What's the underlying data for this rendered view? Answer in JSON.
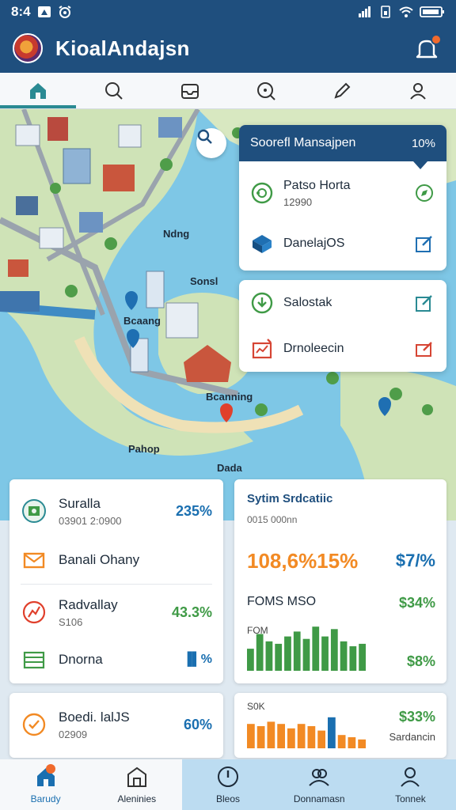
{
  "status_bar": {
    "time": "8:4"
  },
  "header": {
    "title": "KioalAndajsn"
  },
  "tabs": [
    {
      "icon": "home-icon"
    },
    {
      "icon": "search-icon"
    },
    {
      "icon": "inbox-icon"
    },
    {
      "icon": "explore-icon"
    },
    {
      "icon": "edit-icon"
    },
    {
      "icon": "profile-icon"
    }
  ],
  "map": {
    "labels": [
      "Ndng",
      "Sonsl",
      "Bcaang",
      "Bcanning",
      "Pahop",
      "Dada"
    ]
  },
  "panel_top": {
    "title": "Soorefl Mansajpen",
    "percent": "10%",
    "items": [
      {
        "label": "Patso Horta",
        "sub": "12990"
      },
      {
        "label": "DanelajOS",
        "sub": ""
      }
    ]
  },
  "panel_mid": {
    "items": [
      {
        "label": "Salostak"
      },
      {
        "label": "Drnoleecin"
      }
    ]
  },
  "card_list": {
    "rows": [
      {
        "label": "Suralla",
        "sub": "03901 2:0900",
        "value": "235%",
        "color": "#1a6fb0"
      },
      {
        "label": "Banali Ohany",
        "sub": "",
        "value": "",
        "color": "#1a6fb0"
      },
      {
        "label": "Radvallay",
        "sub": "S106",
        "value": "43.3%",
        "color": "#3f9a46"
      },
      {
        "label": "Dnorna",
        "sub": "",
        "value": "▐▌%",
        "color": "#1a6fb0"
      }
    ]
  },
  "card_stats": {
    "title": "Sytim Srdcatiic",
    "sub": "0015 000nn",
    "big_value": "108,6%15%",
    "big_right": "$7/%",
    "fo_label": "FOMS MSO",
    "fo_value": "$34%",
    "fom_label": "FOM",
    "bars_value": "$8%",
    "green_bars": [
      0.45,
      0.75,
      0.6,
      0.55,
      0.7,
      0.8,
      0.65,
      0.9,
      0.7,
      0.85,
      0.6,
      0.5,
      0.55
    ],
    "colors": {
      "green": "#3f9a46",
      "orange": "#f28a24",
      "blue": "#1a6fb0"
    }
  },
  "card_bottom_left": {
    "label": "Boedi. lalJS",
    "sub": "02909",
    "value": "60%"
  },
  "card_bottom_right": {
    "small": "S0K",
    "value": "$33%",
    "label": "Sardancin",
    "orange_bars": [
      0.55,
      0.5,
      0.6,
      0.55,
      0.45,
      0.55,
      0.5,
      0.4,
      0.7,
      0.3,
      0.25,
      0.2
    ]
  },
  "bottom_nav": [
    {
      "label": "Barudy",
      "icon": "home-icon"
    },
    {
      "label": "Aleninies",
      "icon": "building-icon"
    },
    {
      "label": "Bleos",
      "icon": "compass-icon"
    },
    {
      "label": "Donnamasn",
      "icon": "people-icon"
    },
    {
      "label": "Tonnek",
      "icon": "person-icon"
    }
  ]
}
